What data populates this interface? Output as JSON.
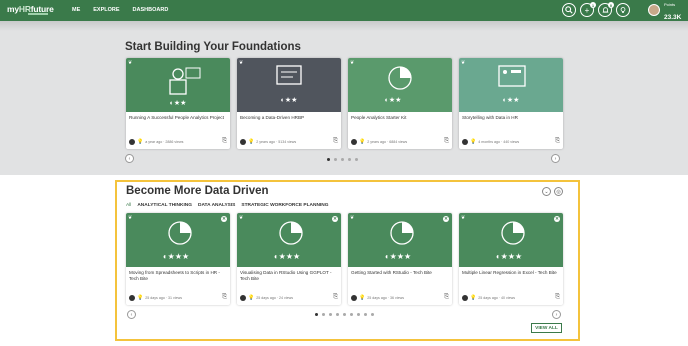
{
  "nav": {
    "logo_prefix": "my",
    "logo_hr": "HR",
    "logo_suffix": "future",
    "links": [
      "ME",
      "EXPLORE",
      "DASHBOARD"
    ],
    "badges": {
      "add": "1",
      "notif": "0"
    },
    "points_label": "Points",
    "points_value": "23.3K"
  },
  "foundations": {
    "title": "Start Building Your Foundations",
    "cards": [
      {
        "title": "Running A Successful People Analytics Project",
        "meta": "a year ago · 2886 views",
        "icon": "analyst-icon"
      },
      {
        "title": "Becoming a Data-Driven HRBP",
        "meta": "2 years ago · 5134 views",
        "icon": "dashboard-icon"
      },
      {
        "title": "People Analytics Starter Kit",
        "meta": "2 years ago · 6884 views",
        "icon": "pie-chart-head-icon"
      },
      {
        "title": "Storytelling with Data in HR",
        "meta": "4 months ago · 440 views",
        "icon": "storyboard-icon"
      }
    ]
  },
  "datadriven": {
    "title": "Become More Data Driven",
    "tabs": [
      "All",
      "ANALYTICAL THINKING",
      "DATA ANALYSIS",
      "STRATEGIC WORKFORCE PLANNING"
    ],
    "cards": [
      {
        "title": "Moving from Spreadsheets to Scripts in HR - Tech Bite",
        "meta": "25 days ago · 31 views"
      },
      {
        "title": "Visualising Data in RStudio Using GGPLOT - Tech Bite",
        "meta": "25 days ago · 24 views"
      },
      {
        "title": "Getting Started with RStudio - Tech Bite",
        "meta": "25 days ago · 36 views"
      },
      {
        "title": "Multiple Linear Regression in Excel - Tech Bite",
        "meta": "25 days ago · 40 views"
      }
    ],
    "view_all": "VIEW ALL"
  },
  "colors": {
    "brand": "#3a7a4a",
    "thumb1": "#4a8a5c",
    "thumb2": "#50555d",
    "thumb3": "#5a9a6c",
    "thumb4": "#6aa890",
    "highlight": "#f4c33c"
  }
}
